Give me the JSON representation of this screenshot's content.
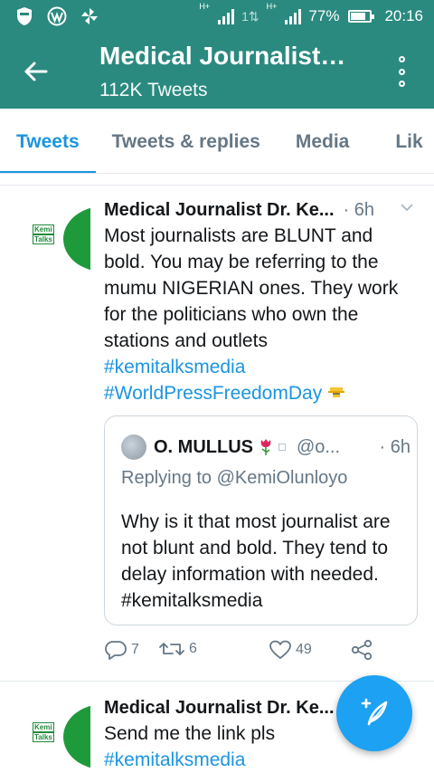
{
  "status_bar": {
    "icons": [
      "shield-icon",
      "wordpress-icon",
      "pinwheel-icon"
    ],
    "network_small_1": "H+",
    "data_arrows": "1⇅",
    "network_small_2": "H+",
    "battery": "77%",
    "time": "20:16",
    "accent_color": "#2a8a7f"
  },
  "header": {
    "title": "Medical Journalist…",
    "subtitle": "112K Tweets"
  },
  "tabs": [
    {
      "label": "Tweets",
      "active": true
    },
    {
      "label": "Tweets & replies",
      "active": false
    },
    {
      "label": "Media",
      "active": false
    },
    {
      "label": "Lik",
      "active": false
    }
  ],
  "tweets": [
    {
      "avatar_text": [
        "Kemi",
        "Talks"
      ],
      "name": "Medical Journalist Dr. Ke...",
      "time": "· 6h",
      "text": "Most journalists are BLUNT and bold. You may be referring to the mumu NIGERIAN ones. They work for the politicians who own the stations and outlets",
      "hashtags": [
        "#kemitalksmedia",
        "#WorldPressFreedomDay"
      ],
      "quote": {
        "name": "O. MULLUS",
        "handle": "@o...",
        "time": "· 6h",
        "replying": "Replying to @KemiOlunloyo",
        "text": "Why is it that most journalist are not blunt and bold. They tend to delay information with needed. #kemitalksmedia"
      },
      "actions": {
        "replies": "7",
        "retweets": "6",
        "likes": "49"
      }
    },
    {
      "avatar_text": [
        "Kemi",
        "Talks"
      ],
      "name": "Medical Journalist Dr. Ke...",
      "text": "Send me the link pls",
      "hashtags": [
        "#kemitalksmedia"
      ]
    }
  ],
  "colors": {
    "link": "#1b95e0",
    "fab": "#1da1f2"
  }
}
